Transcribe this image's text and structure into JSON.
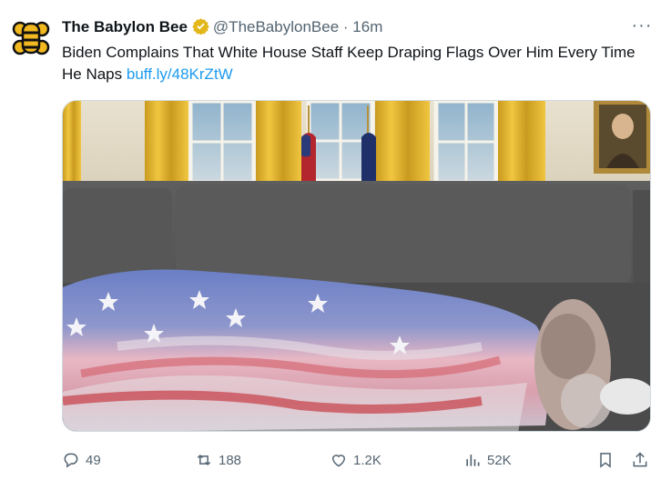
{
  "tweet": {
    "author_name": "The Babylon Bee",
    "handle": "@TheBabylonBee",
    "separator": "·",
    "time": "16m",
    "text": "Biden Complains That White House Staff Keep Draping Flags Over Him Every Time He Naps",
    "link": "buff.ly/48KrZtW",
    "more_icon": "more-icon",
    "verified_color": "#e2b719"
  },
  "actions": {
    "replies": "49",
    "reposts": "188",
    "likes": "1.2K",
    "views": "52K"
  },
  "colors": {
    "text": "#0f1419",
    "secondary": "#536471",
    "link": "#1d9bf0"
  }
}
